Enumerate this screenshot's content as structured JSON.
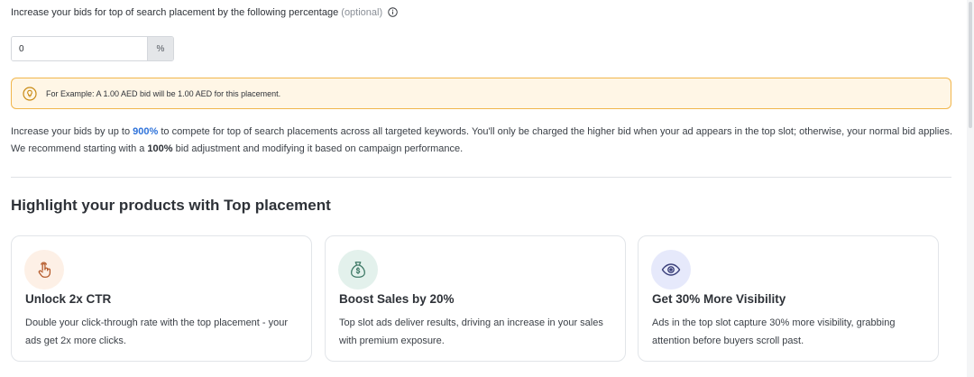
{
  "bid_adjustment": {
    "label": "Increase your bids for top of search placement by the following percentage",
    "optional_label": "(optional)",
    "input_value": "0",
    "suffix": "%"
  },
  "example": {
    "text": "For Example: A 1.00 AED bid will be 1.00 AED for this placement."
  },
  "description": {
    "part1": "Increase your bids by up to ",
    "highlight_max": "900%",
    "part2": " to compete for top of search placements across all targeted keywords. You'll only be charged the higher bid when your ad appears in the top slot; otherwise, your normal bid applies. We recommend starting with a ",
    "highlight_recommend": "100%",
    "part3": " bid adjustment and modifying it based on campaign performance."
  },
  "section": {
    "title": "Highlight your products with Top placement"
  },
  "cards": [
    {
      "icon": "pointer-hand-icon",
      "icon_bg": "#fdf0e6",
      "icon_color": "#b55a2a",
      "title": "Unlock 2x CTR",
      "body": "Double your click-through rate with the top placement - your ads get 2x more clicks."
    },
    {
      "icon": "money-bag-icon",
      "icon_bg": "#e3f1ec",
      "icon_color": "#3f7a67",
      "title": "Boost Sales by 20%",
      "body": "Top slot ads deliver results, driving an increase in your sales with premium exposure."
    },
    {
      "icon": "eye-icon",
      "icon_bg": "#e6e9fb",
      "icon_color": "#3a3f7a",
      "title": "Get 30% More Visibility",
      "body": "Ads in the top slot capture 30% more visibility, grabbing attention before buyers scroll past."
    }
  ]
}
